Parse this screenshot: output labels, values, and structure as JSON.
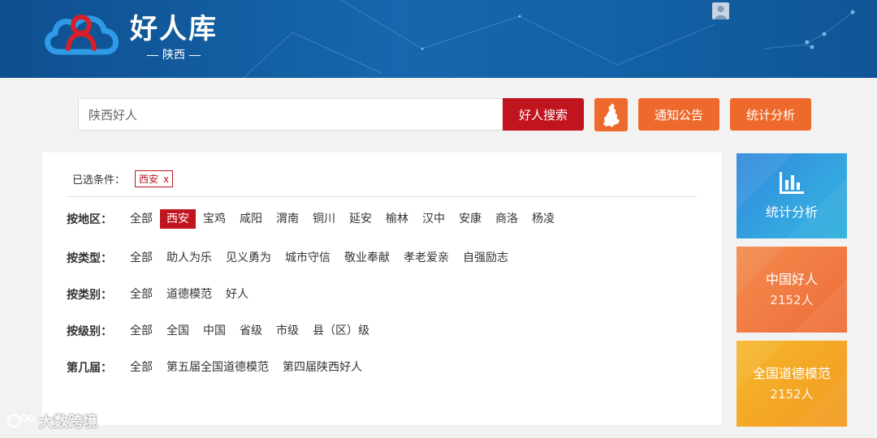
{
  "header": {
    "brand_title": "好人库",
    "brand_subtitle": "陕西",
    "logo_icon": "cloud-person-icon",
    "brand_color": "#1461a6"
  },
  "search": {
    "value": "陕西好人",
    "button_label": "好人搜索",
    "map_icon": "shaanxi-map-icon"
  },
  "top_buttons": {
    "notice_label": "通知公告",
    "stats_label": "统计分析"
  },
  "selected": {
    "label": "已选条件：",
    "tag": "西安",
    "remove": "x"
  },
  "filters": [
    {
      "label": "按地区：",
      "options": [
        "全部",
        "西安",
        "宝鸡",
        "咸阳",
        "渭南",
        "铜川",
        "延安",
        "榆林",
        "汉中",
        "安康",
        "商洛",
        "杨凌"
      ],
      "active": "西安"
    },
    {
      "label": "按类型：",
      "options": [
        "全部",
        "助人为乐",
        "见义勇为",
        "城市守信",
        "敬业奉献",
        "孝老爱亲",
        "自强励志"
      ]
    },
    {
      "label": "按类别：",
      "options": [
        "全部",
        "道德模范",
        "好人"
      ]
    },
    {
      "label": "按级别：",
      "options": [
        "全部",
        "全国",
        "中国",
        "省级",
        "市级",
        "县（区）级"
      ]
    },
    {
      "label": "第几届：",
      "options": [
        "全部",
        "第五届全国道德模范",
        "第四届陕西好人"
      ]
    }
  ],
  "cards": {
    "stats": {
      "title": "统计分析",
      "icon": "bar-chart-icon"
    },
    "china_good": {
      "title": "中国好人",
      "count": "2152人"
    },
    "moral_model": {
      "title": "全国道德模范",
      "count": "2152人"
    }
  },
  "watermark": "大数跨境",
  "colors": {
    "accent_red": "#c0141e",
    "orange": "#ee6a2c",
    "blue_card": "#2f94de",
    "yellow_card": "#f4a825"
  }
}
